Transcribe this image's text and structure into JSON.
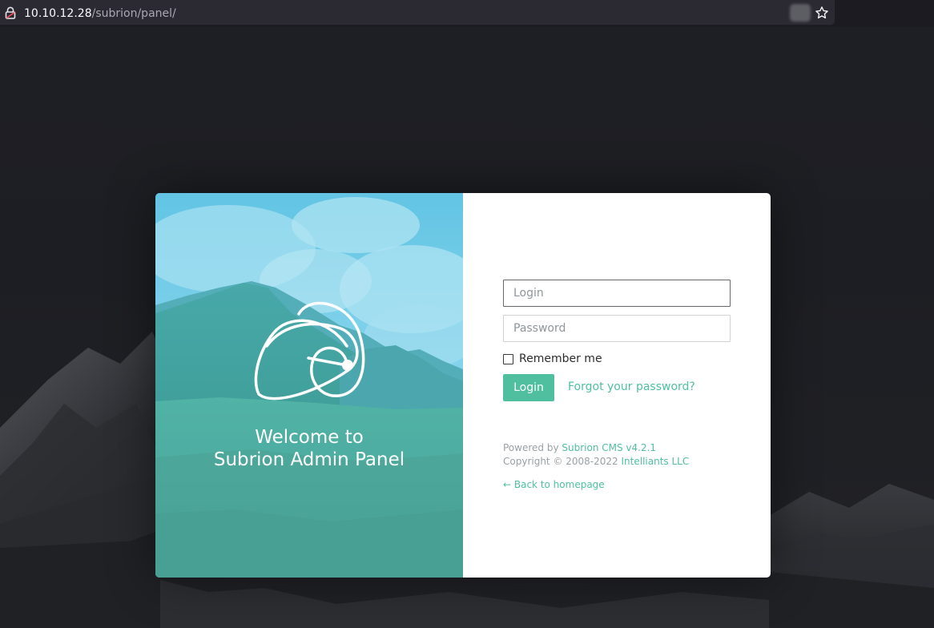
{
  "browser": {
    "url_host": "10.10.12.28",
    "url_path": "/subrion/panel/",
    "lock_icon": "lock-icon",
    "bookmark_icon": "star-icon"
  },
  "panel": {
    "welcome_line1": "Welcome to",
    "welcome_line2": "Subrion Admin Panel",
    "logo_icon": "subrion-logo"
  },
  "form": {
    "login_placeholder": "Login",
    "password_placeholder": "Password",
    "remember_label": "Remember me",
    "remember_checked": false,
    "login_button": "Login",
    "forgot_link": "Forgot your password?"
  },
  "footer": {
    "powered_prefix": "Powered by",
    "powered_link": "Subrion CMS v4.2.1",
    "copyright_prefix": "Copyright © 2008-2022",
    "copyright_link": "Intelliants LLC",
    "back_link": "← Back to homepage"
  },
  "colors": {
    "accent": "#4fbf9f",
    "page_background": "#1d1e23",
    "card_overlay": "#3cb4d2"
  }
}
